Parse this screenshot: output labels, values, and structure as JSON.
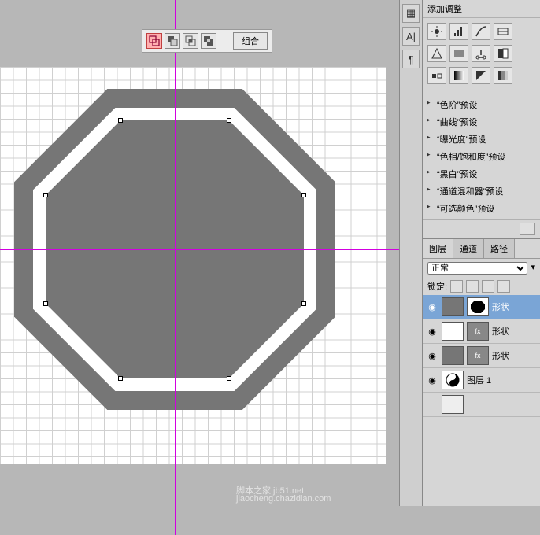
{
  "toolbar": {
    "combine_label": "组合",
    "icons": [
      "overlap-icon",
      "subtract-icon",
      "intersect-icon",
      "exclude-icon"
    ]
  },
  "vstrip": {
    "items": [
      {
        "name": "swatches-icon",
        "glyph": "▦"
      },
      {
        "name": "character-icon",
        "glyph": "A|"
      },
      {
        "name": "paragraph-icon",
        "glyph": "¶"
      }
    ]
  },
  "adjustments": {
    "title": "添加调整",
    "presets": [
      "“色阶”预设",
      "“曲线”预设",
      "“曝光度”预设",
      "“色相/饱和度”预设",
      "“黑白”预设",
      "“通道混和器”预设",
      "“可选颜色”预设"
    ]
  },
  "layers": {
    "tabs": [
      "图层",
      "通道",
      "路径"
    ],
    "active_tab": 0,
    "blend_mode": "正常",
    "lock_label": "锁定:",
    "items": [
      {
        "name": "形状",
        "selected": true,
        "has_mask": true
      },
      {
        "name": "形状",
        "selected": false,
        "has_fx": true
      },
      {
        "name": "形状",
        "selected": false,
        "has_fx": true
      },
      {
        "name": "图层 1",
        "selected": false,
        "yinyang": true
      }
    ]
  },
  "watermarks": {
    "w1": "脚本之家 jb51.net",
    "w2": "jiaocheng.chazidian.com"
  },
  "colors": {
    "shape": "#767676",
    "guide": "#d200e0",
    "sel": "#7aa5d6"
  }
}
